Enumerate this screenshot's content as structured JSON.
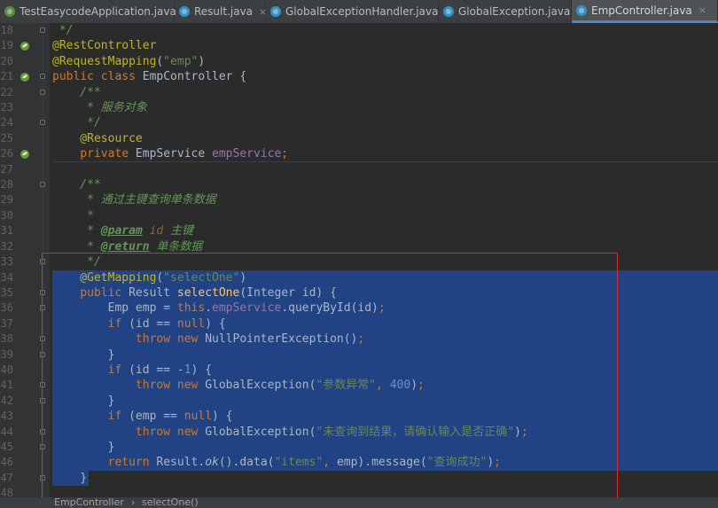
{
  "tabs": [
    {
      "label": "TestEasycodeApplication.java",
      "icon": "spring-class-icon",
      "active": false
    },
    {
      "label": "Result.java",
      "icon": "java-class-icon",
      "active": false
    },
    {
      "label": "GlobalExceptionHandler.java",
      "icon": "java-class-icon",
      "active": false
    },
    {
      "label": "GlobalException.java",
      "icon": "java-class-icon",
      "active": false
    },
    {
      "label": "EmpController.java",
      "icon": "java-class-icon",
      "active": true
    }
  ],
  "close_glyph": "×",
  "selection_color": "#214283",
  "highlight_box_color": "#e0282c",
  "lines": [
    {
      "n": "18",
      "t": [
        {
          "c": "cmt",
          "v": " */"
        }
      ]
    },
    {
      "n": "19",
      "t": [
        {
          "c": "ann",
          "v": "@RestController"
        }
      ]
    },
    {
      "n": "20",
      "t": [
        {
          "c": "ann",
          "v": "@RequestMapping"
        },
        {
          "c": "",
          "v": "("
        },
        {
          "c": "str",
          "v": "\"emp\""
        },
        {
          "c": "",
          "v": ")"
        }
      ]
    },
    {
      "n": "21",
      "t": [
        {
          "c": "kw",
          "v": "public class "
        },
        {
          "c": "",
          "v": "EmpController {"
        }
      ]
    },
    {
      "n": "22",
      "t": [
        {
          "c": "cmt",
          "v": "    /**"
        }
      ]
    },
    {
      "n": "23",
      "t": [
        {
          "c": "cmt",
          "v": "     * 服务对象"
        }
      ]
    },
    {
      "n": "24",
      "t": [
        {
          "c": "cmt",
          "v": "     */"
        }
      ]
    },
    {
      "n": "25",
      "t": [
        {
          "c": "ann",
          "v": "    @Resource"
        }
      ]
    },
    {
      "n": "26",
      "t": [
        {
          "c": "kw",
          "v": "    private "
        },
        {
          "c": "",
          "v": "EmpService "
        },
        {
          "c": "fld",
          "v": "empService"
        },
        {
          "c": "kw",
          "v": ";"
        }
      ]
    },
    {
      "n": "27",
      "t": []
    },
    {
      "n": "28",
      "t": [
        {
          "c": "cmt",
          "v": "    /**"
        }
      ]
    },
    {
      "n": "29",
      "t": [
        {
          "c": "cmt",
          "v": "     * 通过主键查询单条数据"
        }
      ]
    },
    {
      "n": "30",
      "t": [
        {
          "c": "cmt",
          "v": "     *"
        }
      ]
    },
    {
      "n": "31",
      "t": [
        {
          "c": "cmt",
          "v": "     * "
        },
        {
          "c": "tag",
          "v": "@param"
        },
        {
          "c": "prm",
          "v": " id"
        },
        {
          "c": "cmt",
          "v": " 主键"
        }
      ]
    },
    {
      "n": "32",
      "t": [
        {
          "c": "cmt",
          "v": "     * "
        },
        {
          "c": "tag",
          "v": "@return"
        },
        {
          "c": "cmt",
          "v": " 单条数据"
        }
      ]
    },
    {
      "n": "33",
      "t": [
        {
          "c": "cmt",
          "v": "     */"
        }
      ]
    },
    {
      "n": "34",
      "t": [
        {
          "c": "ann",
          "v": "    @GetMapping"
        },
        {
          "c": "",
          "v": "("
        },
        {
          "c": "str",
          "v": "\"selectOne\""
        },
        {
          "c": "",
          "v": ")"
        }
      ]
    },
    {
      "n": "35",
      "t": [
        {
          "c": "kw",
          "v": "    public "
        },
        {
          "c": "",
          "v": "Result "
        },
        {
          "c": "mth",
          "v": "selectOne"
        },
        {
          "c": "",
          "v": "(Integer id) {"
        }
      ]
    },
    {
      "n": "36",
      "t": [
        {
          "c": "",
          "v": "        Emp emp = "
        },
        {
          "c": "kw",
          "v": "this"
        },
        {
          "c": "",
          "v": "."
        },
        {
          "c": "fld",
          "v": "empService"
        },
        {
          "c": "",
          "v": ".queryById(id)"
        },
        {
          "c": "kw",
          "v": ";"
        }
      ]
    },
    {
      "n": "37",
      "t": [
        {
          "c": "kw",
          "v": "        if "
        },
        {
          "c": "",
          "v": "(id == "
        },
        {
          "c": "kw",
          "v": "null"
        },
        {
          "c": "",
          "v": ") {"
        }
      ]
    },
    {
      "n": "38",
      "t": [
        {
          "c": "kw",
          "v": "            throw new "
        },
        {
          "c": "",
          "v": "NullPointerException()"
        },
        {
          "c": "kw",
          "v": ";"
        }
      ]
    },
    {
      "n": "39",
      "t": [
        {
          "c": "",
          "v": "        }"
        }
      ]
    },
    {
      "n": "40",
      "t": [
        {
          "c": "kw",
          "v": "        if "
        },
        {
          "c": "",
          "v": "(id == -"
        },
        {
          "c": "num",
          "v": "1"
        },
        {
          "c": "",
          "v": ") {"
        }
      ]
    },
    {
      "n": "41",
      "t": [
        {
          "c": "kw",
          "v": "            throw new "
        },
        {
          "c": "",
          "v": "GlobalException("
        },
        {
          "c": "str",
          "v": "\"参数异常\""
        },
        {
          "c": "kw",
          "v": ", "
        },
        {
          "c": "num",
          "v": "400"
        },
        {
          "c": "",
          "v": ")"
        },
        {
          "c": "kw",
          "v": ";"
        }
      ]
    },
    {
      "n": "42",
      "t": [
        {
          "c": "",
          "v": "        }"
        }
      ]
    },
    {
      "n": "43",
      "t": [
        {
          "c": "kw",
          "v": "        if "
        },
        {
          "c": "",
          "v": "(emp == "
        },
        {
          "c": "kw",
          "v": "null"
        },
        {
          "c": "",
          "v": ") {"
        }
      ]
    },
    {
      "n": "44",
      "t": [
        {
          "c": "kw",
          "v": "            throw new "
        },
        {
          "c": "",
          "v": "GlobalException("
        },
        {
          "c": "str",
          "v": "\"未查询到结果，请确认输入是否正确\""
        },
        {
          "c": "",
          "v": ")"
        },
        {
          "c": "kw",
          "v": ";"
        }
      ]
    },
    {
      "n": "45",
      "t": [
        {
          "c": "",
          "v": "        }"
        }
      ]
    },
    {
      "n": "46",
      "t": [
        {
          "c": "kw",
          "v": "        return "
        },
        {
          "c": "",
          "v": "Result."
        },
        {
          "c": "ital",
          "v": "ok"
        },
        {
          "c": "",
          "v": "().data("
        },
        {
          "c": "str",
          "v": "\"items\""
        },
        {
          "c": "kw",
          "v": ", "
        },
        {
          "c": "",
          "v": "emp).message("
        },
        {
          "c": "str",
          "v": "\"查询成功\""
        },
        {
          "c": "",
          "v": ")"
        },
        {
          "c": "kw",
          "v": ";"
        }
      ]
    },
    {
      "n": "47",
      "t": [
        {
          "c": "",
          "v": "    }"
        }
      ]
    },
    {
      "n": "48",
      "t": []
    }
  ],
  "breadcrumb": {
    "class_name": "EmpController",
    "separator": "›",
    "method_name": "selectOne()"
  }
}
